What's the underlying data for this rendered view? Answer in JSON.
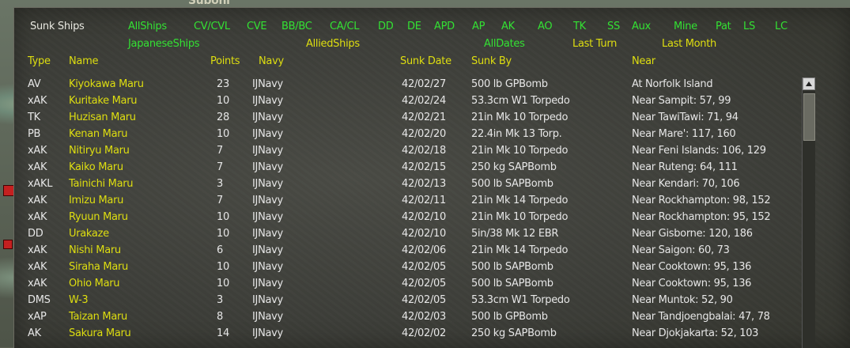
{
  "map": {
    "label": "Subohi"
  },
  "window": {
    "title": "Sunk Ships"
  },
  "filters": {
    "types": [
      "AllShips",
      "CV/CVL",
      "CVE",
      "BB/BC",
      "CA/CL",
      "DD",
      "DE",
      "APD",
      "AP",
      "AK",
      "AO",
      "TK",
      "SS",
      "Aux",
      "Mine",
      "Pat",
      "LS",
      "LC"
    ],
    "side_japanese": "JapaneseShips",
    "side_allied": "AlliedShips",
    "date_all": "AllDates",
    "date_last_turn": "Last Turn",
    "date_last_month": "Last Month"
  },
  "columns": {
    "type": "Type",
    "name": "Name",
    "points": "Points",
    "navy": "Navy",
    "sunk_date": "Sunk Date",
    "sunk_by": "Sunk By",
    "near": "Near"
  },
  "rows": [
    {
      "type": "AV",
      "name": "Kiyokawa Maru",
      "points": "23",
      "navy": "IJNavy",
      "date": "42/02/27",
      "by": "500 lb GPBomb",
      "near": "At Norfolk Island"
    },
    {
      "type": "xAK",
      "name": "Kuritake Maru",
      "points": "10",
      "navy": "IJNavy",
      "date": "42/02/24",
      "by": "53.3cm W1 Torpedo",
      "near": "Near Sampit: 57, 99"
    },
    {
      "type": "TK",
      "name": "Huzisan Maru",
      "points": "28",
      "navy": "IJNavy",
      "date": "42/02/21",
      "by": "21in Mk 10 Torpedo",
      "near": "Near TawiTawi: 71, 94"
    },
    {
      "type": "PB",
      "name": "Kenan Maru",
      "points": "10",
      "navy": "IJNavy",
      "date": "42/02/20",
      "by": "22.4in Mk 13 Torp.",
      "near": "Near Mare': 117, 160"
    },
    {
      "type": "xAK",
      "name": "Nitiryu Maru",
      "points": "7",
      "navy": "IJNavy",
      "date": "42/02/18",
      "by": "21in Mk 10 Torpedo",
      "near": "Near Feni Islands: 106, 129"
    },
    {
      "type": "xAK",
      "name": "Kaiko Maru",
      "points": "7",
      "navy": "IJNavy",
      "date": "42/02/15",
      "by": "250 kg SAPBomb",
      "near": "Near Ruteng: 64, 111"
    },
    {
      "type": "xAKL",
      "name": "Tainichi Maru",
      "points": "3",
      "navy": "IJNavy",
      "date": "42/02/13",
      "by": "500 lb SAPBomb",
      "near": "Near Kendari: 70, 106"
    },
    {
      "type": "xAK",
      "name": "Imizu Maru",
      "points": "7",
      "navy": "IJNavy",
      "date": "42/02/11",
      "by": "21in Mk 14 Torpedo",
      "near": "Near Rockhampton: 98, 152"
    },
    {
      "type": "xAK",
      "name": "Ryuun Maru",
      "points": "10",
      "navy": "IJNavy",
      "date": "42/02/10",
      "by": "21in Mk 10 Torpedo",
      "near": "Near Rockhampton: 95, 152"
    },
    {
      "type": "DD",
      "name": "Urakaze",
      "points": "10",
      "navy": "IJNavy",
      "date": "42/02/10",
      "by": "5in/38 Mk 12 EBR",
      "near": "Near Gisborne: 120, 186"
    },
    {
      "type": "xAK",
      "name": "Nishi Maru",
      "points": "6",
      "navy": "IJNavy",
      "date": "42/02/06",
      "by": "21in Mk 14 Torpedo",
      "near": "Near Saigon: 60, 73"
    },
    {
      "type": "xAK",
      "name": "Siraha Maru",
      "points": "10",
      "navy": "IJNavy",
      "date": "42/02/05",
      "by": "500 lb SAPBomb",
      "near": "Near Cooktown: 95, 136"
    },
    {
      "type": "xAK",
      "name": "Ohio Maru",
      "points": "10",
      "navy": "IJNavy",
      "date": "42/02/05",
      "by": "500 lb SAPBomb",
      "near": "Near Cooktown: 95, 136"
    },
    {
      "type": "DMS",
      "name": "W-3",
      "points": "3",
      "navy": "IJNavy",
      "date": "42/02/05",
      "by": "53.3cm W1 Torpedo",
      "near": "Near Muntok: 52, 90"
    },
    {
      "type": "xAP",
      "name": "Taizan Maru",
      "points": "8",
      "navy": "IJNavy",
      "date": "42/02/03",
      "by": "500 lb GPBomb",
      "near": "Near Tandjoengbalai: 47, 78"
    },
    {
      "type": "AK",
      "name": "Sakura Maru",
      "points": "14",
      "navy": "IJNavy",
      "date": "42/02/02",
      "by": "250 kg SAPBomb",
      "near": "Near Djokjakarta: 52, 103"
    }
  ],
  "colors": {
    "filter_green": "#33e133",
    "header_yellow": "#dede10",
    "cell_white": "#e6e6e6"
  }
}
